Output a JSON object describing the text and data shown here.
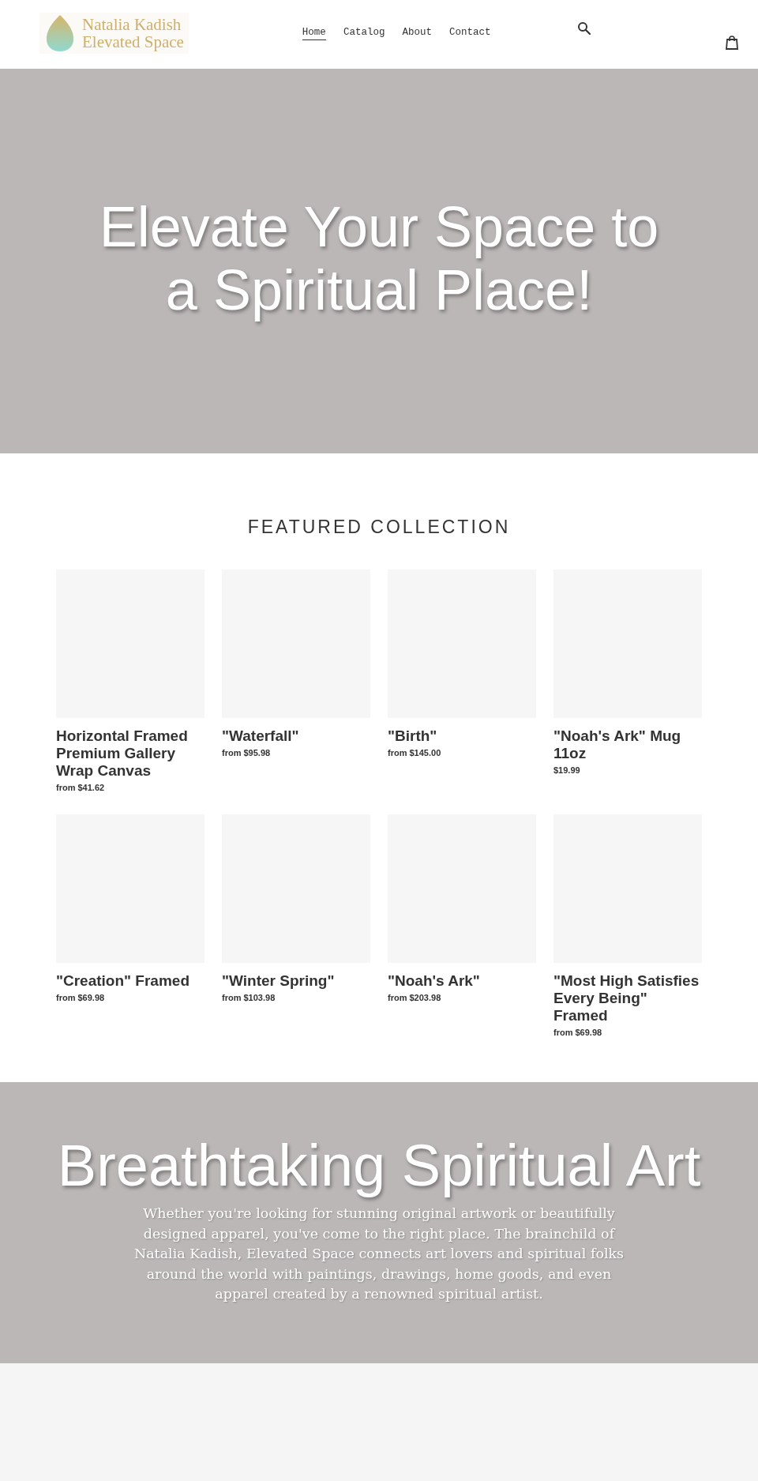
{
  "header": {
    "logo": {
      "line_1": "Natalia Kadish",
      "line_2": "Elevated Space"
    },
    "nav": [
      {
        "label": "Home",
        "selected": true
      },
      {
        "label": "Catalog",
        "selected": false
      },
      {
        "label": "About",
        "selected": false
      },
      {
        "label": "Contact",
        "selected": false
      }
    ]
  },
  "hero": {
    "heading": "Elevate Your Space to a Spiritual Place!"
  },
  "featured": {
    "title": "FEATURED COLLECTION",
    "products": [
      {
        "name": "Horizontal Framed Premium Gallery Wrap Canvas",
        "price": "from $41.62"
      },
      {
        "name": "\"Waterfall\"",
        "price": "from $95.98"
      },
      {
        "name": "\"Birth\"",
        "price": "from $145.00"
      },
      {
        "name": "\"Noah's Ark\" Mug 11oz",
        "price": "$19.99"
      },
      {
        "name": "\"Creation\" Framed",
        "price": "from $69.98"
      },
      {
        "name": "\"Winter Spring\"",
        "price": "from $103.98"
      },
      {
        "name": "\"Noah's Ark\"",
        "price": "from $203.98"
      },
      {
        "name": "\"Most High Satisfies Every Being\" Framed",
        "price": "from $69.98"
      }
    ]
  },
  "banner": {
    "heading": "Breathtaking Spiritual Art",
    "text": "Whether you're looking for stunning original artwork or beautifully designed apparel, you've come to the right place. The brainchild of Natalia Kadish, Elevated Space connects art lovers and spiritual folks around the world with paintings, drawings, home goods, and even apparel created by a renowned spiritual artist."
  }
}
